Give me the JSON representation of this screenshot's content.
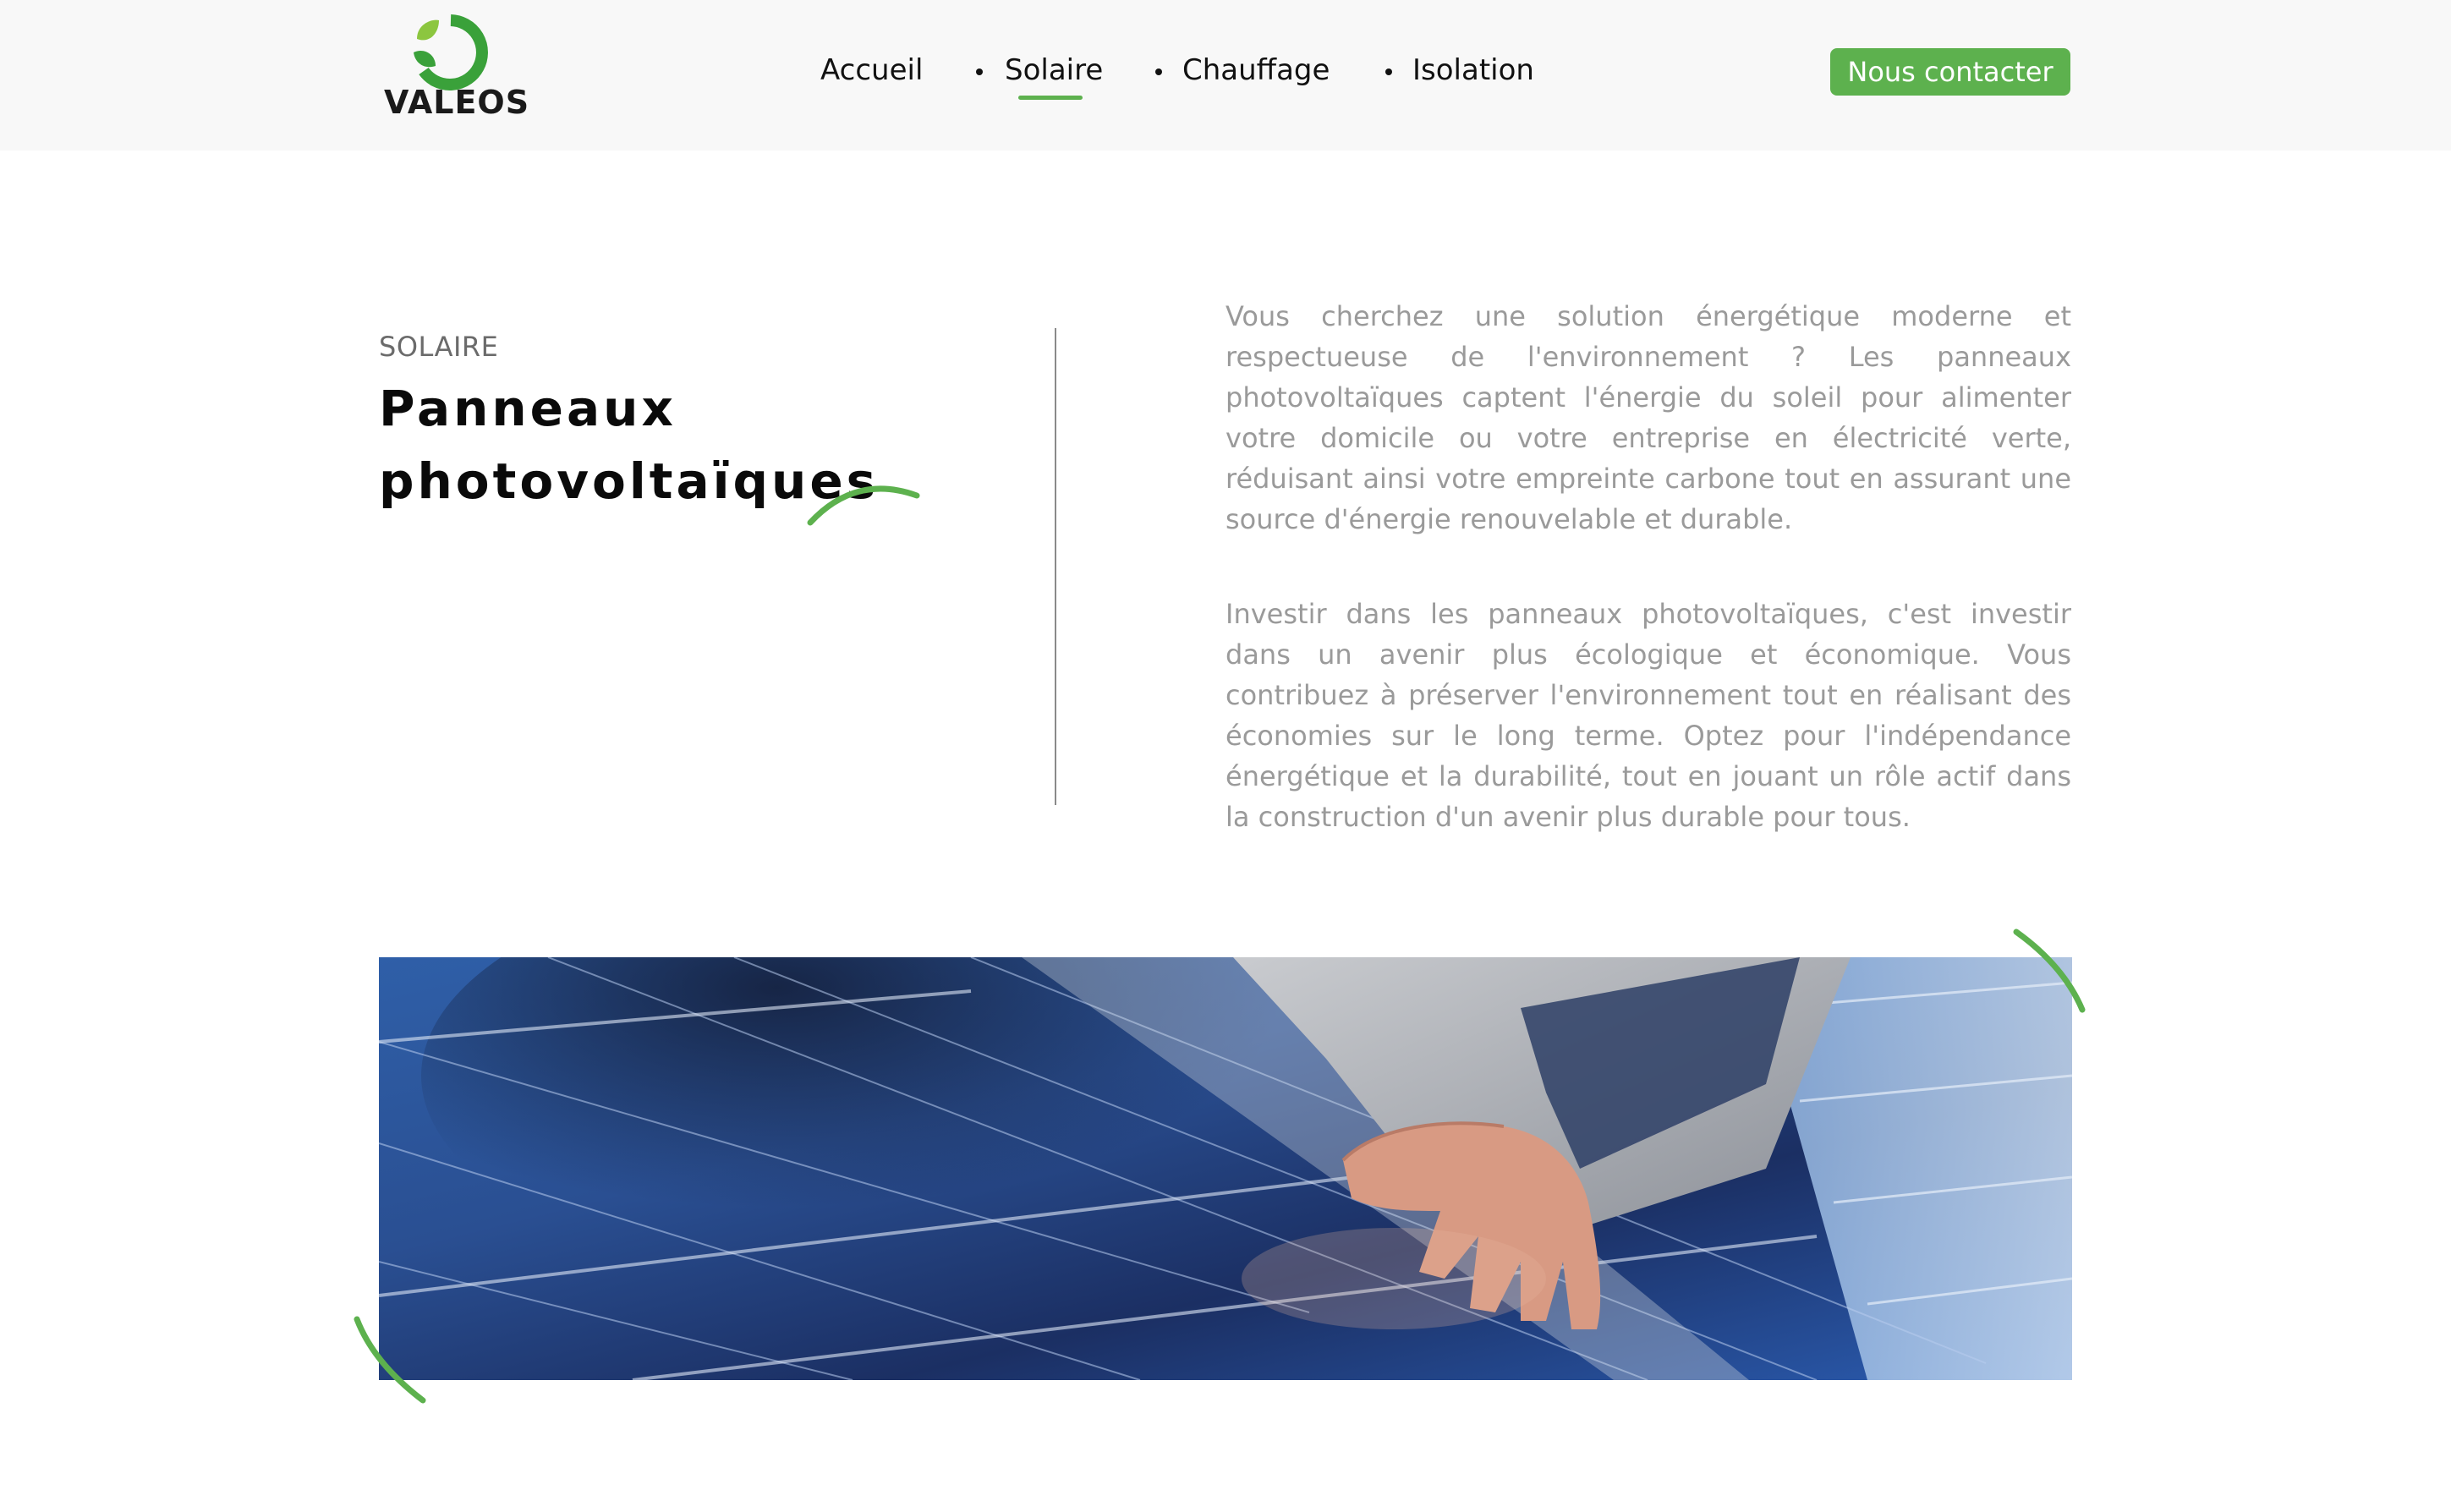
{
  "brand": {
    "name": "VALEOS",
    "accent_color": "#5db14e",
    "logo_icon": "leaf-ring-logo-icon"
  },
  "nav": {
    "items": [
      {
        "label": "Accueil",
        "active": false
      },
      {
        "label": "Solaire",
        "active": true
      },
      {
        "label": "Chauffage",
        "active": false
      },
      {
        "label": "Isolation",
        "active": false
      }
    ]
  },
  "header": {
    "cta_label": "Nous contacter"
  },
  "intro": {
    "eyebrow": "SOLAIRE",
    "title_line_1": "Panneaux",
    "title_line_2": "photovoltaïques",
    "paragraph_1": "Vous cherchez une solution énergétique moderne et respectueuse de l'environnement ? Les panneaux photovoltaïques captent l'énergie du soleil pour alimenter votre domicile ou votre entreprise en électricité verte, réduisant ainsi votre empreinte carbone tout en assurant une source d'énergie renouvelable et durable.",
    "paragraph_2": "Investir dans les panneaux photovoltaïques, c'est investir dans un avenir plus écologique et économique. Vous contribuez à préserver l'environnement tout en réalisant des économies sur le long terme. Optez pour l'indépendance énergétique et la durabilité, tout en jouant un rôle actif dans la construction d'un avenir plus durable pour tous."
  },
  "banner": {
    "image_subject": "hand-on-solar-panel-photo"
  }
}
